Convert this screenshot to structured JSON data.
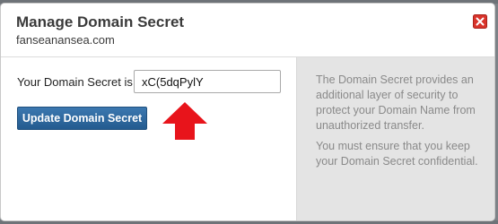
{
  "dialog": {
    "title": "Manage Domain Secret",
    "domain": "fanseanansea.com",
    "close_icon": "close-icon",
    "close_color": "#d9342b"
  },
  "form": {
    "label": "Your Domain Secret is :",
    "secret_value": "xC(5dqPylY",
    "button_label": "Update Domain Secret",
    "button_color": "#2a62a0"
  },
  "annotation": {
    "icon": "red-arrow-up-icon",
    "color": "#e8141b"
  },
  "info": {
    "paragraph_1": "The Domain Secret provides an additional layer of security to protect your Domain Name from unauthorized transfer.",
    "paragraph_2": "You must ensure that you keep your Domain Secret confidential."
  }
}
